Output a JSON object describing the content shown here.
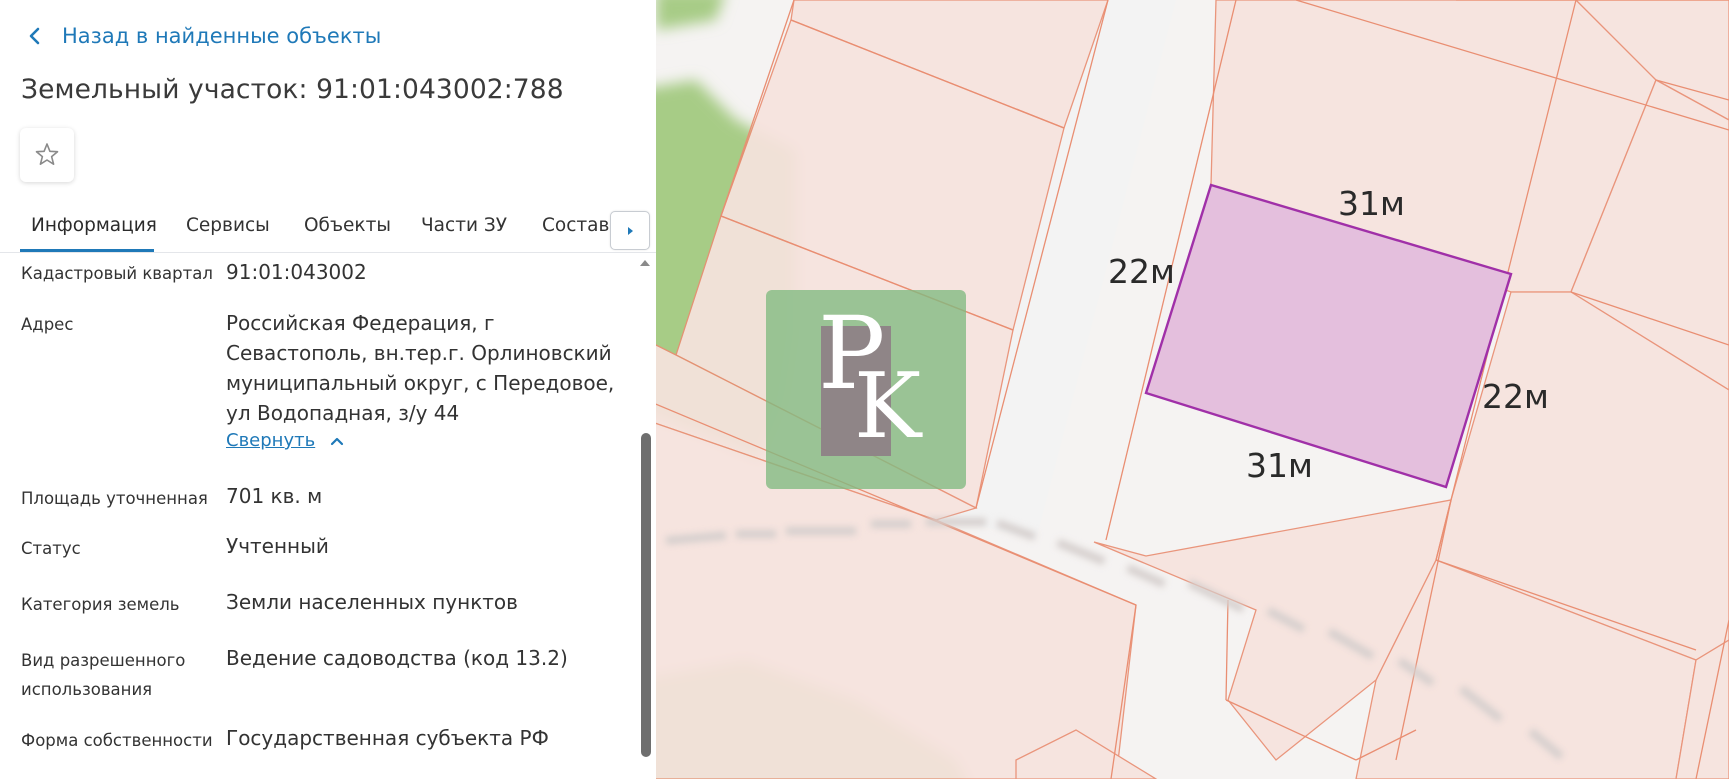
{
  "nav": {
    "back_label": "Назад в найденные объекты"
  },
  "object": {
    "title": "Земельный участок: 91:01:043002:788"
  },
  "tabs": [
    {
      "label": "Информация",
      "active": true
    },
    {
      "label": "Сервисы"
    },
    {
      "label": "Объекты"
    },
    {
      "label": "Части ЗУ"
    },
    {
      "label": "Состав"
    }
  ],
  "info": {
    "rows": [
      {
        "label": "Кадастровый квартал",
        "value": "91:01:043002"
      },
      {
        "label": "Адрес",
        "value": "Российская Федерация, г Севастополь, вн.тер.г. Орлиновский муниципальный округ, с Передовое, ул Водопадная, з/у 44",
        "action": "Свернуть"
      },
      {
        "label": "Площадь уточненная",
        "value": "701 кв. м"
      },
      {
        "label": "Статус",
        "value": "Учтенный"
      },
      {
        "label": "Категория земель",
        "value": "Земли населенных пунктов"
      },
      {
        "label": "Вид разрешенного использования",
        "value": "Ведение садоводства (код 13.2)"
      },
      {
        "label": "Форма собственности",
        "value": "Государственная субъекта РФ"
      }
    ]
  },
  "map": {
    "dimensions": {
      "top": "31м",
      "bottom": "31м",
      "left": "22м",
      "right": "22м"
    },
    "colors": {
      "parcel_fill": "#e4bfdd",
      "parcel_stroke": "#a030a8",
      "neighbor_fill": "#f7e3de",
      "neighbor_stroke": "#e98e72",
      "green": "#a7cc86"
    }
  },
  "theme": {
    "accent": "#1f79b8"
  },
  "icons": {
    "back": "chevron-left-icon",
    "favorite": "star-outline-icon",
    "tabs_next": "caret-right-icon",
    "collapse": "chevron-up-icon"
  }
}
